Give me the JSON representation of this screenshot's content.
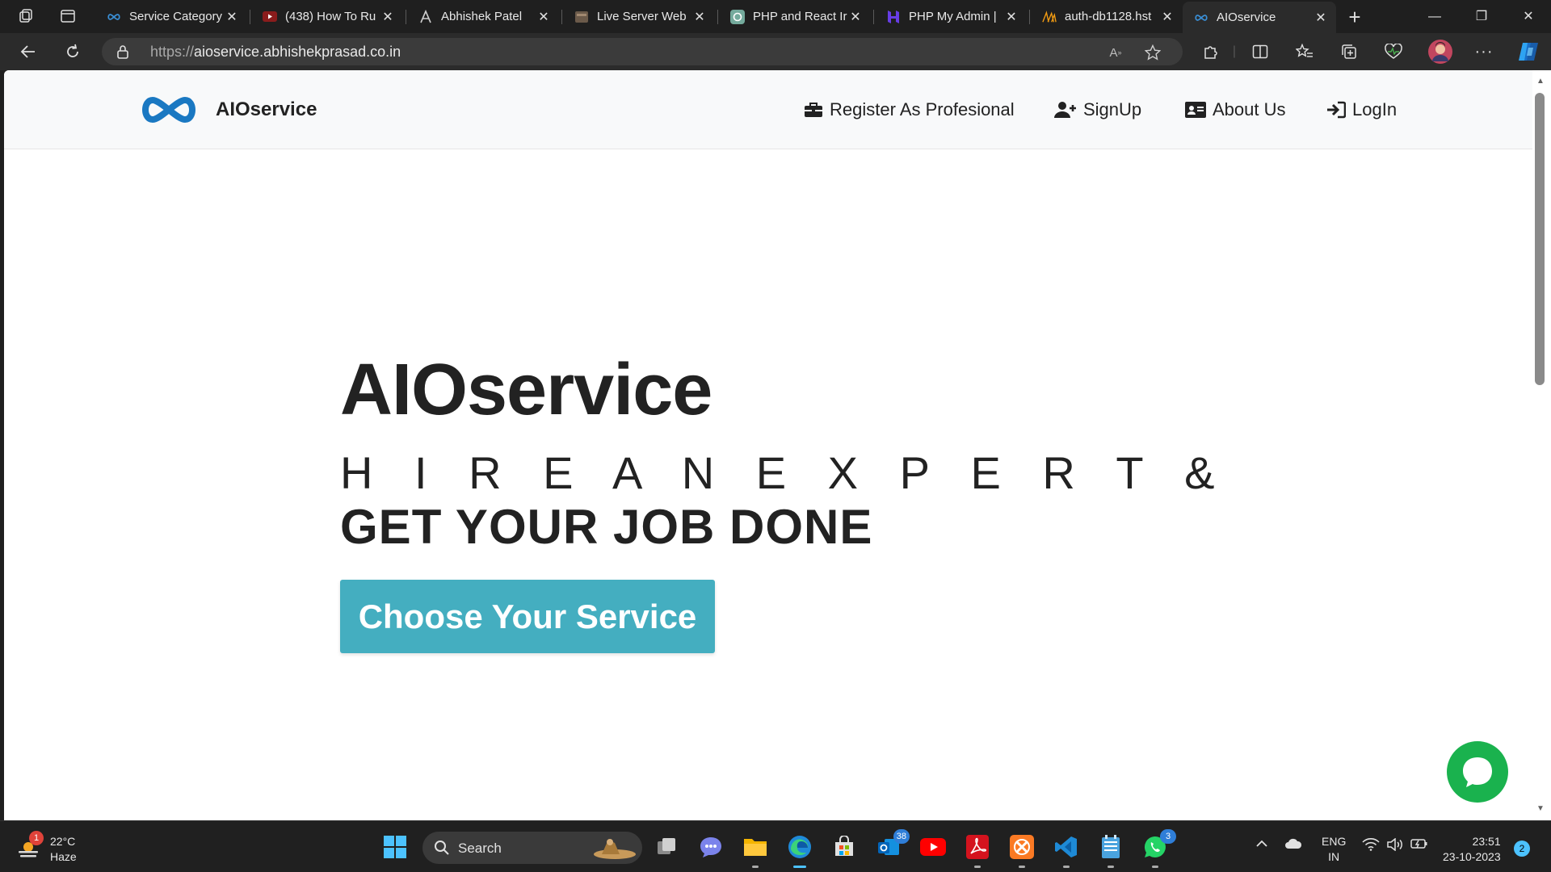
{
  "browser": {
    "tabs": [
      {
        "title": "Service Category",
        "active": false
      },
      {
        "title": "(438) How To Ru",
        "active": false
      },
      {
        "title": "Abhishek Patel",
        "active": false
      },
      {
        "title": "Live Server Web",
        "active": false
      },
      {
        "title": "PHP and React Ir",
        "active": false
      },
      {
        "title": "PHP My Admin |",
        "active": false
      },
      {
        "title": "auth-db1128.hst",
        "active": false
      },
      {
        "title": "AIOservice",
        "active": true
      }
    ],
    "url_protocol": "https://",
    "url_host": "aioservice.abhishekprasad.co.in"
  },
  "page": {
    "brand_name": "AIOservice",
    "nav": [
      {
        "label": "Register As Profesional",
        "icon": "briefcase-icon"
      },
      {
        "label": "SignUp",
        "icon": "user-plus-icon"
      },
      {
        "label": "About Us",
        "icon": "id-card-icon"
      },
      {
        "label": "LogIn",
        "icon": "sign-in-icon"
      }
    ],
    "hero": {
      "title": "AIOservice",
      "subtitle_line1": "H I R E  A N  E X P E R T &",
      "subtitle_line2": "GET YOUR JOB DONE",
      "cta_label": "Choose Your Service"
    },
    "colors": {
      "accent": "#44aec0",
      "logo_blue": "#1a78c2",
      "chat_green": "#1ab24e"
    }
  },
  "taskbar": {
    "weather": {
      "temp": "22°C",
      "condition": "Haze",
      "badge": "1"
    },
    "search_label": "Search",
    "badges": {
      "outlook": "38",
      "whatsapp": "3"
    },
    "lang_line1": "ENG",
    "lang_line2": "IN",
    "time": "23:51",
    "date": "23-10-2023",
    "notifications": "2"
  }
}
